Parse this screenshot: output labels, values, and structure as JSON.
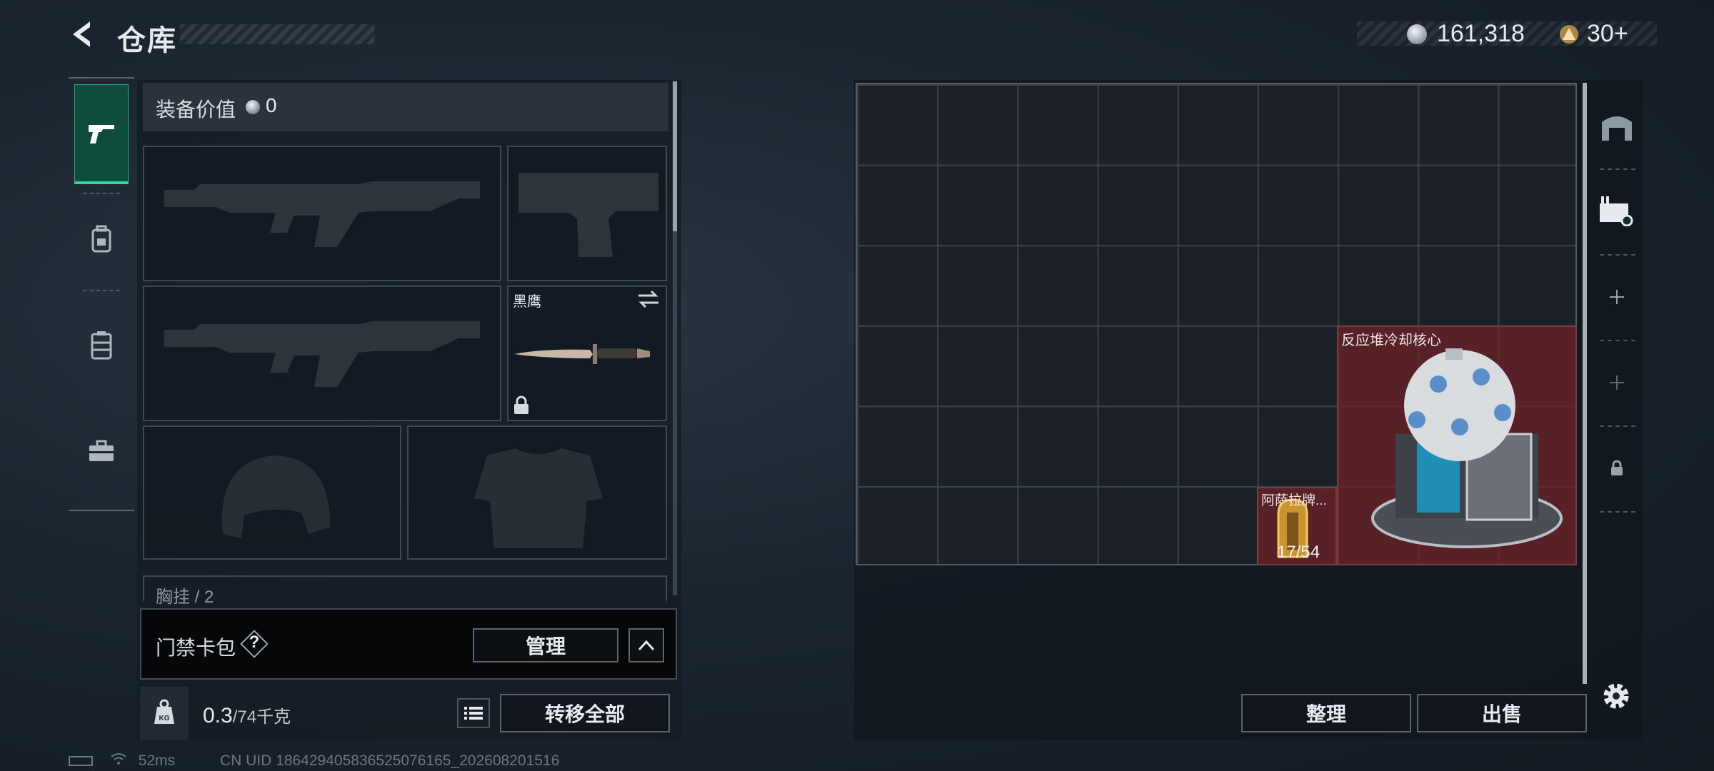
{
  "header": {
    "title": "仓库",
    "currency_primary": "161,318",
    "currency_secondary": "30+"
  },
  "equipment": {
    "value_label": "装备价值",
    "value_amount": "0",
    "melee_name": "黑鹰",
    "partial_slot_label": "胸挂 / 2",
    "keycard_label": "门禁卡包",
    "help_label": "?",
    "manage_label": "管理",
    "weight_current": "0.3",
    "weight_capacity": "/74千克",
    "transfer_all_label": "转移全部"
  },
  "storage": {
    "items": [
      {
        "name": "反应堆冷却核心"
      },
      {
        "name": "阿萨拉牌...",
        "count": "17/54"
      }
    ],
    "sort_label": "整理",
    "sell_label": "出售"
  },
  "status": {
    "ping": "52ms",
    "uid": "CN UID 18642940583652507616​5_202608201516"
  },
  "colors": {
    "accent_green": "#3bd394",
    "item_red": "#6e2028"
  }
}
